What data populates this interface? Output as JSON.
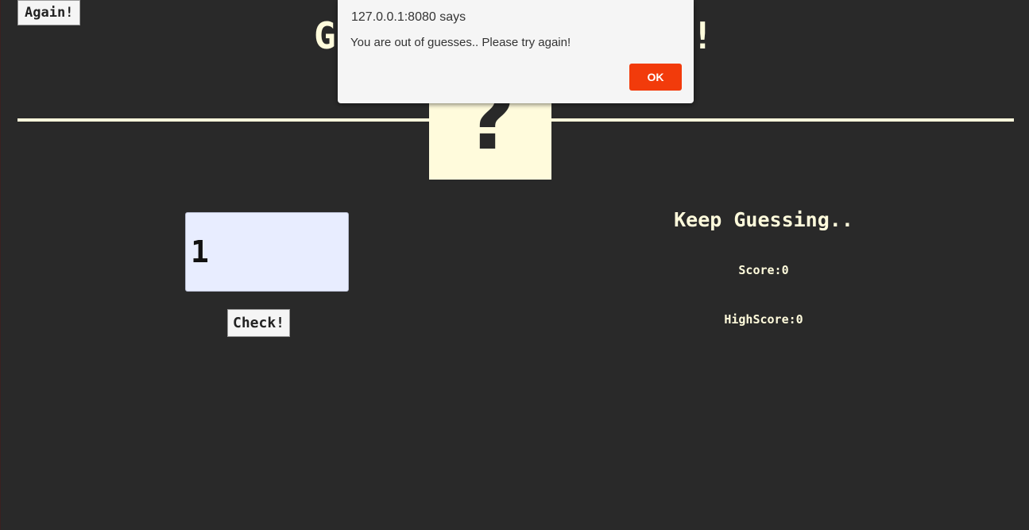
{
  "game": {
    "again_label": "Again!",
    "title": "Guess My Number!",
    "secret_display": "?",
    "guess_value": "1",
    "check_label": "Check!",
    "message": "Keep Guessing..",
    "score_text": "Score:0",
    "highscore_text": "HighScore:0"
  },
  "alert": {
    "origin": "127.0.0.1:8080 says",
    "message": "You are out of guesses.. Please try again!",
    "ok_label": "OK"
  },
  "colors": {
    "background": "#292929",
    "accent": "#fffbdc",
    "input_bg": "#e8edff",
    "ok_button": "#f23b0b"
  }
}
